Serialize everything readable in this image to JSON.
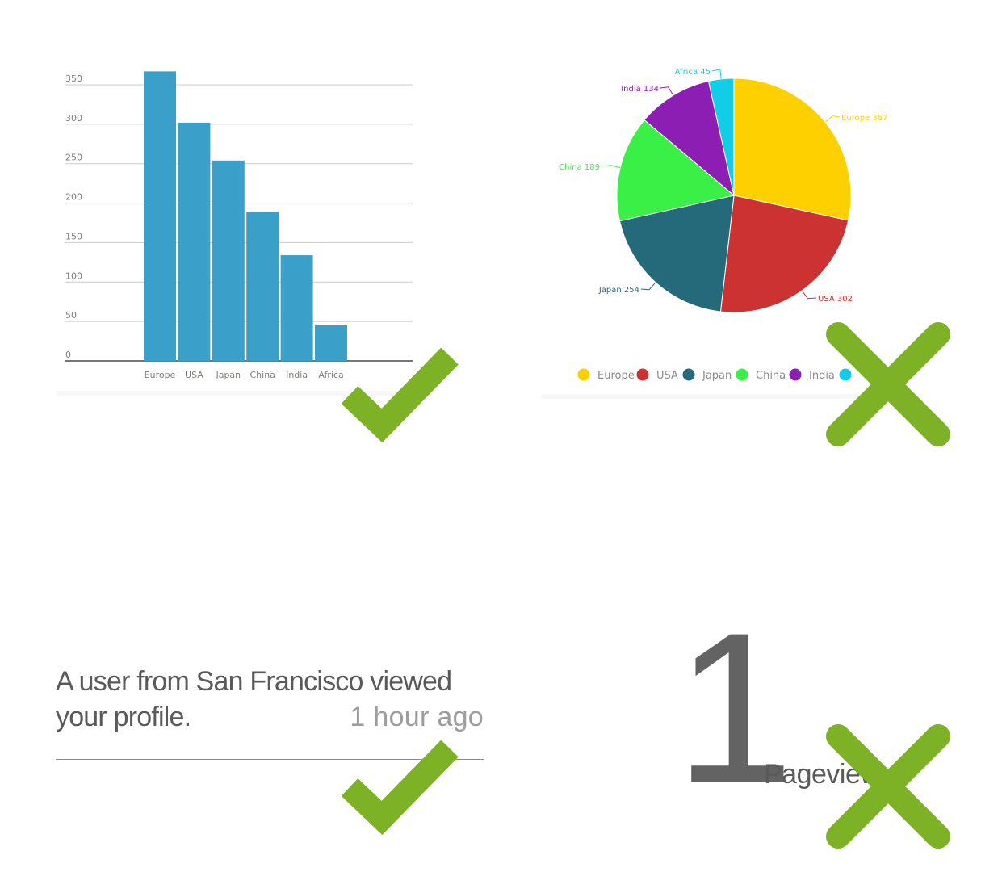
{
  "chart_data": [
    {
      "type": "bar",
      "categories": [
        "Europe",
        "USA",
        "Japan",
        "China",
        "India",
        "Africa"
      ],
      "values": [
        367,
        302,
        254,
        189,
        134,
        45
      ],
      "ylim": [
        0,
        350
      ],
      "yticks": [
        0,
        50,
        100,
        150,
        200,
        250,
        300,
        350
      ],
      "grid": true,
      "color": "#3aa0c9"
    },
    {
      "type": "pie",
      "categories": [
        "Europe",
        "USA",
        "Japan",
        "China",
        "India",
        "Africa"
      ],
      "values": [
        367,
        302,
        254,
        189,
        134,
        45
      ],
      "labels": [
        "Europe 367",
        "USA 302",
        "Japan 254",
        "China 189",
        "India 134",
        "Africa 45"
      ],
      "colors": [
        "#ffd000",
        "#cd3232",
        "#256a7a",
        "#3af046",
        "#8c1eb4",
        "#11cde6"
      ],
      "legend": {
        "placement": "bottom",
        "entries": [
          "Europe",
          "USA",
          "Japan",
          "China",
          "India"
        ]
      }
    }
  ],
  "feed": {
    "message": "A user from San Francisco viewed your profile.",
    "time": "1 hour ago"
  },
  "metric": {
    "value": "1",
    "label": "Pageviews"
  },
  "marks": {
    "color": "#7db227",
    "items": [
      "check",
      "cross",
      "check",
      "cross"
    ]
  }
}
